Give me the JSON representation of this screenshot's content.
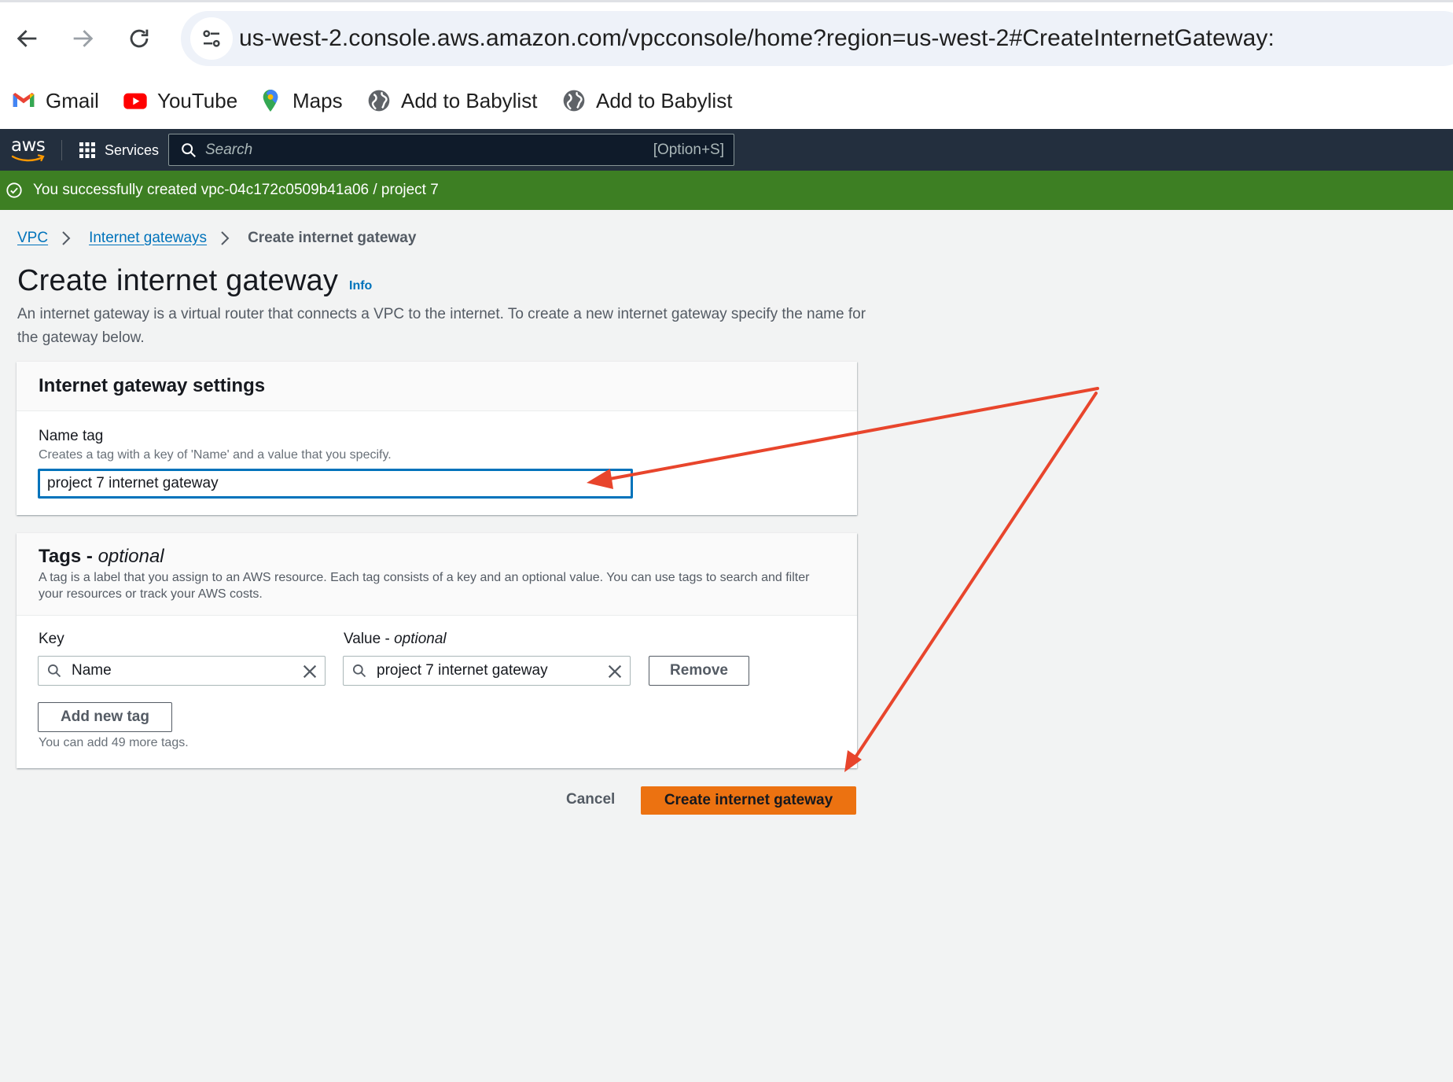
{
  "browser": {
    "url": "us-west-2.console.aws.amazon.com/vpcconsole/home?region=us-west-2#CreateInternetGateway:",
    "bookmarks": [
      {
        "label": "Gmail",
        "icon": "gmail-icon"
      },
      {
        "label": "YouTube",
        "icon": "youtube-icon"
      },
      {
        "label": "Maps",
        "icon": "maps-icon"
      },
      {
        "label": "Add to Babylist",
        "icon": "globe-icon"
      },
      {
        "label": "Add to Babylist",
        "icon": "globe-icon"
      }
    ]
  },
  "aws_nav": {
    "logo_text": "aws",
    "services_label": "Services",
    "search_placeholder": "Search",
    "search_shortcut": "[Option+S]"
  },
  "flash": {
    "message": "You successfully created vpc-04c172c0509b41a06 / project 7",
    "color": "#3d7f23"
  },
  "breadcrumb": {
    "items": [
      "VPC",
      "Internet gateways"
    ],
    "current": "Create internet gateway"
  },
  "page": {
    "title": "Create internet gateway",
    "info_link": "Info",
    "description": "An internet gateway is a virtual router that connects a VPC to the internet. To create a new internet gateway specify the name for the gateway below."
  },
  "settings_panel": {
    "title": "Internet gateway settings",
    "name_tag_label": "Name tag",
    "name_tag_description": "Creates a tag with a key of 'Name' and a value that you specify.",
    "name_tag_value": "project 7 internet gateway"
  },
  "tags_panel": {
    "title": "Tags - ",
    "title_suffix": "optional",
    "description": "A tag is a label that you assign to an AWS resource. Each tag consists of a key and an optional value. You can use tags to search and filter your resources or track your AWS costs.",
    "key_label": "Key",
    "value_label": "Value - ",
    "value_label_suffix": "optional",
    "tags": [
      {
        "key": "Name",
        "value": "project 7 internet gateway"
      }
    ],
    "remove_label": "Remove",
    "add_tag_label": "Add new tag",
    "remaining_hint": "You can add 49 more tags."
  },
  "actions": {
    "cancel_label": "Cancel",
    "create_label": "Create internet gateway",
    "primary_color": "#ec7211"
  },
  "annotation": {
    "arrow_color": "#e8452c"
  }
}
